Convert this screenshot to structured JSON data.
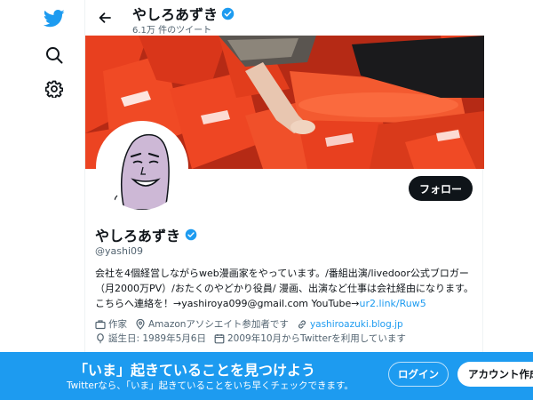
{
  "nav": {
    "icons": [
      "twitter-logo-icon",
      "search-icon",
      "settings-icon"
    ]
  },
  "header": {
    "name": "やしろあずき",
    "tweet_count": "6.1万 件のツイート"
  },
  "profile": {
    "display_name": "やしろあずき",
    "handle": "@yashi09",
    "follow_label": "フォロー",
    "bio_text": "会社を4個経営しながらweb漫画家をやっています。/番組出演/livedoor公式ブロガー（月2000万PV）/おたくのやどかり役員/ 漫画、出演など仕事は会社経由になります。こちらへ連絡を！→yashiroya099@gmail.com YouTube→",
    "bio_link": "ur2.link/Ruw5",
    "category": "作家",
    "location": "Amazonアソシエイト参加者です",
    "website": "yashiroazuki.blog.jp",
    "birthday": "誕生日: 1989年5月6日",
    "joined": "2009年10月からTwitterを利用しています"
  },
  "bottom_bar": {
    "title": "「いま」起きていることを見つけよう",
    "subtitle": "Twitterなら、「いま」起きていることをいち早くチェックできます。",
    "login_label": "ログイン",
    "signup_label": "アカウント作成"
  },
  "colors": {
    "brand": "#1d9bf0",
    "text": "#0f1419",
    "secondary": "#536471",
    "banner_cones": "#e8401f"
  }
}
